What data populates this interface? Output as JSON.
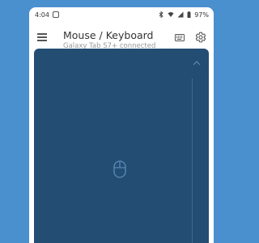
{
  "status_bar": {
    "time": "4:04",
    "battery": "97%"
  },
  "app_bar": {
    "title": "Mouse / Keyboard",
    "subtitle": "Galaxy Tab S7+ connected",
    "icons": [
      "menu-icon",
      "keyboard-icon",
      "gear-icon"
    ]
  },
  "touchpad": {
    "icons": [
      "chevron-up-icon",
      "mouse-icon"
    ]
  },
  "colors": {
    "background": "#4a8fce",
    "touchpad": "#244d73",
    "touchpad_icon": "#5b8bb8"
  }
}
